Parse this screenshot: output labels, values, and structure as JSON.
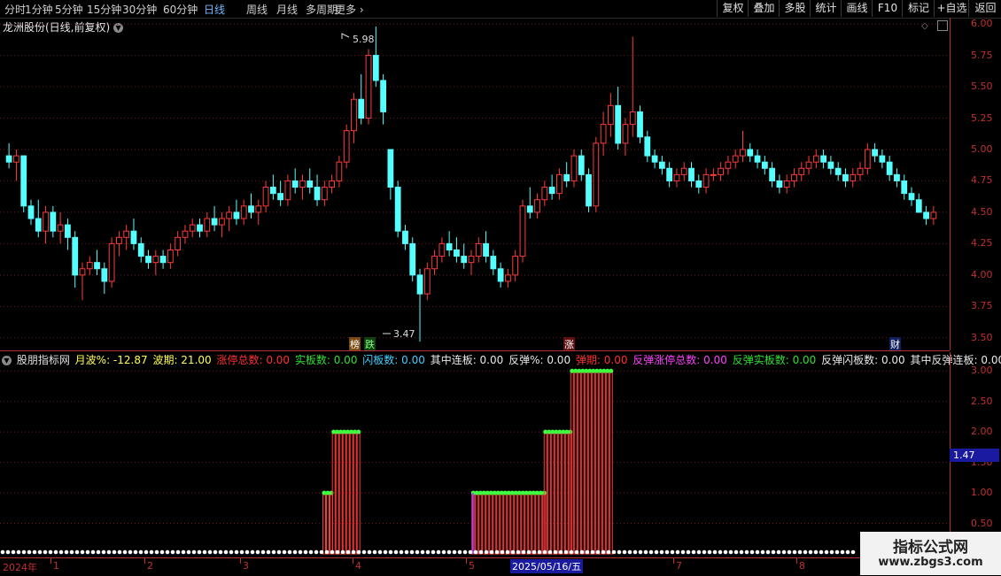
{
  "toolbar": {
    "tabs": [
      "分时",
      "1分钟",
      "5分钟",
      "15分钟",
      "30分钟",
      "60分钟",
      "日线",
      "周线",
      "月线",
      "多周期",
      "更多"
    ],
    "active_tab": "日线",
    "right_buttons": [
      "复权",
      "叠加",
      "多股",
      "统计",
      "画线",
      "F10",
      "标记",
      "+自选",
      "返回"
    ]
  },
  "stock": {
    "title": "龙洲股份(日线,前复权)"
  },
  "main_axis": {
    "labels": [
      "6.00",
      "5.75",
      "5.50",
      "5.25",
      "5.00",
      "4.75",
      "4.50",
      "4.25",
      "4.00",
      "3.75",
      "3.50"
    ]
  },
  "annotations": {
    "high": "5.98",
    "low": "3.47",
    "event_bang": "榜",
    "event_die": "跌",
    "event_zhang": "涨",
    "event_cai": "财"
  },
  "indicator": {
    "name": "股朋指标网",
    "items": [
      {
        "label": "月波%",
        "value": "-12.87",
        "color": "#ffff55"
      },
      {
        "label": "波期",
        "value": "21.00",
        "color": "#ffff55"
      },
      {
        "label": "涨停总数",
        "value": "0.00",
        "color": "#ff3030"
      },
      {
        "label": "实板数",
        "value": "0.00",
        "color": "#30e030"
      },
      {
        "label": "闪板数",
        "value": "0.00",
        "color": "#40d0ff"
      },
      {
        "label": "其中连板",
        "value": "0.00",
        "color": "#e8e8e8"
      },
      {
        "label": "反弹%",
        "value": "0.00",
        "color": "#e8e8e8"
      },
      {
        "label": "弹期",
        "value": "0.00",
        "color": "#ff3030"
      },
      {
        "label": "反弹涨停总数",
        "value": "0.00",
        "color": "#ff40ff"
      },
      {
        "label": "反弹实板数",
        "value": "0.00",
        "color": "#30e030"
      },
      {
        "label": "反弹闪板数",
        "value": "0.00",
        "color": "#e8e8e8"
      },
      {
        "label": "其中反弹连板",
        "value": "0.00",
        "color": "#e8e8e8"
      }
    ],
    "axis_labels": [
      "3.00",
      "2.50",
      "2.00",
      "1.50",
      "1.00",
      "0.50"
    ],
    "current_value": "1.47"
  },
  "dates": {
    "year": "2024年",
    "months": [
      "1",
      "2",
      "3",
      "4",
      "5",
      "7",
      "8"
    ],
    "selected": "2025/05/16/五"
  },
  "watermark": {
    "title": "指标公式网",
    "url": "www.zbgs3.com"
  },
  "colors": {
    "up": "#ff3a3a",
    "down": "#54ffff",
    "axis": "#c03030",
    "grid": "#6a1a1a",
    "marker": "#40ff40"
  },
  "chart_data": {
    "type": "candlestick",
    "price_range": [
      3.4,
      6.05
    ],
    "candles_ohlc": [
      [
        4.95,
        5.05,
        4.85,
        4.9
      ],
      [
        4.9,
        5.0,
        4.75,
        4.95
      ],
      [
        4.95,
        4.95,
        4.5,
        4.55
      ],
      [
        4.55,
        4.6,
        4.4,
        4.45
      ],
      [
        4.45,
        4.6,
        4.3,
        4.35
      ],
      [
        4.35,
        4.55,
        4.25,
        4.5
      ],
      [
        4.5,
        4.55,
        4.3,
        4.35
      ],
      [
        4.35,
        4.5,
        4.25,
        4.4
      ],
      [
        4.4,
        4.45,
        4.2,
        4.3
      ],
      [
        4.3,
        4.35,
        3.9,
        4.0
      ],
      [
        4.0,
        4.1,
        3.8,
        4.05
      ],
      [
        4.05,
        4.15,
        4.0,
        4.1
      ],
      [
        4.1,
        4.2,
        4.0,
        4.05
      ],
      [
        4.05,
        4.1,
        3.85,
        3.95
      ],
      [
        3.95,
        4.3,
        3.9,
        4.25
      ],
      [
        4.25,
        4.35,
        4.15,
        4.3
      ],
      [
        4.3,
        4.4,
        4.2,
        4.35
      ],
      [
        4.35,
        4.45,
        4.2,
        4.25
      ],
      [
        4.25,
        4.3,
        4.1,
        4.15
      ],
      [
        4.15,
        4.2,
        4.05,
        4.1
      ],
      [
        4.1,
        4.2,
        4.0,
        4.15
      ],
      [
        4.15,
        4.2,
        4.05,
        4.1
      ],
      [
        4.1,
        4.25,
        4.05,
        4.2
      ],
      [
        4.2,
        4.35,
        4.15,
        4.3
      ],
      [
        4.3,
        4.4,
        4.25,
        4.35
      ],
      [
        4.35,
        4.45,
        4.3,
        4.4
      ],
      [
        4.4,
        4.45,
        4.3,
        4.35
      ],
      [
        4.35,
        4.5,
        4.3,
        4.45
      ],
      [
        4.45,
        4.55,
        4.35,
        4.4
      ],
      [
        4.4,
        4.5,
        4.3,
        4.45
      ],
      [
        4.45,
        4.55,
        4.35,
        4.5
      ],
      [
        4.5,
        4.6,
        4.4,
        4.45
      ],
      [
        4.45,
        4.6,
        4.4,
        4.55
      ],
      [
        4.55,
        4.65,
        4.45,
        4.5
      ],
      [
        4.5,
        4.6,
        4.4,
        4.55
      ],
      [
        4.55,
        4.75,
        4.5,
        4.7
      ],
      [
        4.7,
        4.8,
        4.6,
        4.65
      ],
      [
        4.65,
        4.75,
        4.55,
        4.6
      ],
      [
        4.6,
        4.8,
        4.55,
        4.75
      ],
      [
        4.75,
        4.85,
        4.65,
        4.7
      ],
      [
        4.7,
        4.8,
        4.6,
        4.75
      ],
      [
        4.75,
        4.85,
        4.65,
        4.7
      ],
      [
        4.7,
        4.8,
        4.55,
        4.6
      ],
      [
        4.6,
        4.75,
        4.55,
        4.7
      ],
      [
        4.7,
        4.8,
        4.65,
        4.75
      ],
      [
        4.75,
        4.95,
        4.7,
        4.9
      ],
      [
        4.9,
        5.2,
        4.85,
        5.15
      ],
      [
        5.15,
        5.45,
        5.05,
        5.4
      ],
      [
        5.4,
        5.6,
        5.2,
        5.25
      ],
      [
        5.25,
        5.8,
        5.2,
        5.75
      ],
      [
        5.75,
        5.98,
        5.5,
        5.55
      ],
      [
        5.55,
        5.6,
        5.2,
        5.3
      ],
      [
        5.0,
        5.0,
        4.6,
        4.7
      ],
      [
        4.7,
        4.75,
        4.3,
        4.35
      ],
      [
        4.35,
        4.4,
        4.2,
        4.25
      ],
      [
        4.25,
        4.3,
        3.95,
        4.0
      ],
      [
        4.0,
        4.05,
        3.47,
        3.85
      ],
      [
        3.85,
        4.1,
        3.8,
        4.05
      ],
      [
        4.05,
        4.2,
        4.0,
        4.15
      ],
      [
        4.15,
        4.3,
        4.1,
        4.25
      ],
      [
        4.25,
        4.35,
        4.15,
        4.2
      ],
      [
        4.2,
        4.3,
        4.1,
        4.15
      ],
      [
        4.15,
        4.25,
        4.05,
        4.1
      ],
      [
        4.1,
        4.2,
        4.0,
        4.15
      ],
      [
        4.15,
        4.3,
        4.1,
        4.25
      ],
      [
        4.25,
        4.35,
        4.1,
        4.15
      ],
      [
        4.15,
        4.2,
        4.0,
        4.05
      ],
      [
        4.05,
        4.1,
        3.9,
        3.95
      ],
      [
        3.95,
        4.05,
        3.9,
        4.0
      ],
      [
        4.0,
        4.2,
        3.95,
        4.15
      ],
      [
        4.15,
        4.6,
        4.1,
        4.55
      ],
      [
        4.55,
        4.7,
        4.45,
        4.5
      ],
      [
        4.5,
        4.65,
        4.45,
        4.6
      ],
      [
        4.6,
        4.75,
        4.55,
        4.7
      ],
      [
        4.7,
        4.8,
        4.6,
        4.65
      ],
      [
        4.65,
        4.85,
        4.6,
        4.8
      ],
      [
        4.8,
        4.9,
        4.7,
        4.75
      ],
      [
        4.75,
        5.0,
        4.7,
        4.95
      ],
      [
        4.95,
        5.0,
        4.75,
        4.8
      ],
      [
        4.8,
        4.85,
        4.5,
        4.55
      ],
      [
        4.55,
        5.1,
        4.5,
        5.05
      ],
      [
        5.05,
        5.3,
        4.95,
        5.2
      ],
      [
        5.2,
        5.45,
        5.1,
        5.35
      ],
      [
        5.35,
        5.5,
        5.0,
        5.05
      ],
      [
        5.05,
        5.25,
        4.95,
        5.2
      ],
      [
        5.2,
        5.9,
        5.1,
        5.3
      ],
      [
        5.3,
        5.35,
        5.05,
        5.1
      ],
      [
        5.1,
        5.15,
        4.9,
        4.95
      ],
      [
        4.95,
        5.0,
        4.85,
        4.9
      ],
      [
        4.9,
        4.95,
        4.8,
        4.85
      ],
      [
        4.85,
        4.9,
        4.7,
        4.75
      ],
      [
        4.75,
        4.85,
        4.7,
        4.8
      ],
      [
        4.8,
        4.9,
        4.75,
        4.85
      ],
      [
        4.85,
        4.9,
        4.7,
        4.75
      ],
      [
        4.75,
        4.8,
        4.65,
        4.7
      ],
      [
        4.7,
        4.85,
        4.65,
        4.8
      ],
      [
        4.8,
        4.85,
        4.75,
        4.8
      ],
      [
        4.8,
        4.9,
        4.75,
        4.85
      ],
      [
        4.85,
        4.95,
        4.8,
        4.9
      ],
      [
        4.9,
        5.0,
        4.85,
        4.95
      ],
      [
        4.95,
        5.15,
        4.9,
        5.0
      ],
      [
        5.0,
        5.05,
        4.9,
        4.95
      ],
      [
        4.95,
        5.0,
        4.85,
        4.9
      ],
      [
        4.9,
        4.95,
        4.8,
        4.85
      ],
      [
        4.85,
        4.9,
        4.7,
        4.75
      ],
      [
        4.75,
        4.8,
        4.65,
        4.7
      ],
      [
        4.7,
        4.8,
        4.65,
        4.75
      ],
      [
        4.75,
        4.85,
        4.7,
        4.8
      ],
      [
        4.8,
        4.9,
        4.75,
        4.85
      ],
      [
        4.85,
        4.95,
        4.8,
        4.9
      ],
      [
        4.9,
        5.0,
        4.85,
        4.95
      ],
      [
        4.95,
        5.0,
        4.85,
        4.9
      ],
      [
        4.9,
        4.95,
        4.8,
        4.85
      ],
      [
        4.85,
        4.9,
        4.75,
        4.8
      ],
      [
        4.8,
        4.85,
        4.7,
        4.75
      ],
      [
        4.75,
        4.85,
        4.7,
        4.8
      ],
      [
        4.8,
        4.9,
        4.75,
        4.85
      ],
      [
        4.85,
        5.05,
        4.8,
        5.0
      ],
      [
        5.0,
        5.05,
        4.9,
        4.95
      ],
      [
        4.95,
        5.0,
        4.85,
        4.9
      ],
      [
        4.9,
        4.95,
        4.75,
        4.8
      ],
      [
        4.8,
        4.85,
        4.7,
        4.75
      ],
      [
        4.75,
        4.8,
        4.6,
        4.65
      ],
      [
        4.65,
        4.7,
        4.55,
        4.6
      ],
      [
        4.6,
        4.65,
        4.5,
        4.5
      ],
      [
        4.5,
        4.55,
        4.4,
        4.45
      ],
      [
        4.45,
        4.55,
        4.4,
        4.5
      ]
    ],
    "indicator_bars": [
      {
        "start": 0.34,
        "end": 0.35,
        "value": 1
      },
      {
        "start": 0.35,
        "end": 0.378,
        "value": 2
      },
      {
        "start": 0.497,
        "end": 0.573,
        "value": 1
      },
      {
        "start": 0.573,
        "end": 0.601,
        "value": 2
      },
      {
        "start": 0.601,
        "end": 0.645,
        "value": 3
      }
    ]
  }
}
